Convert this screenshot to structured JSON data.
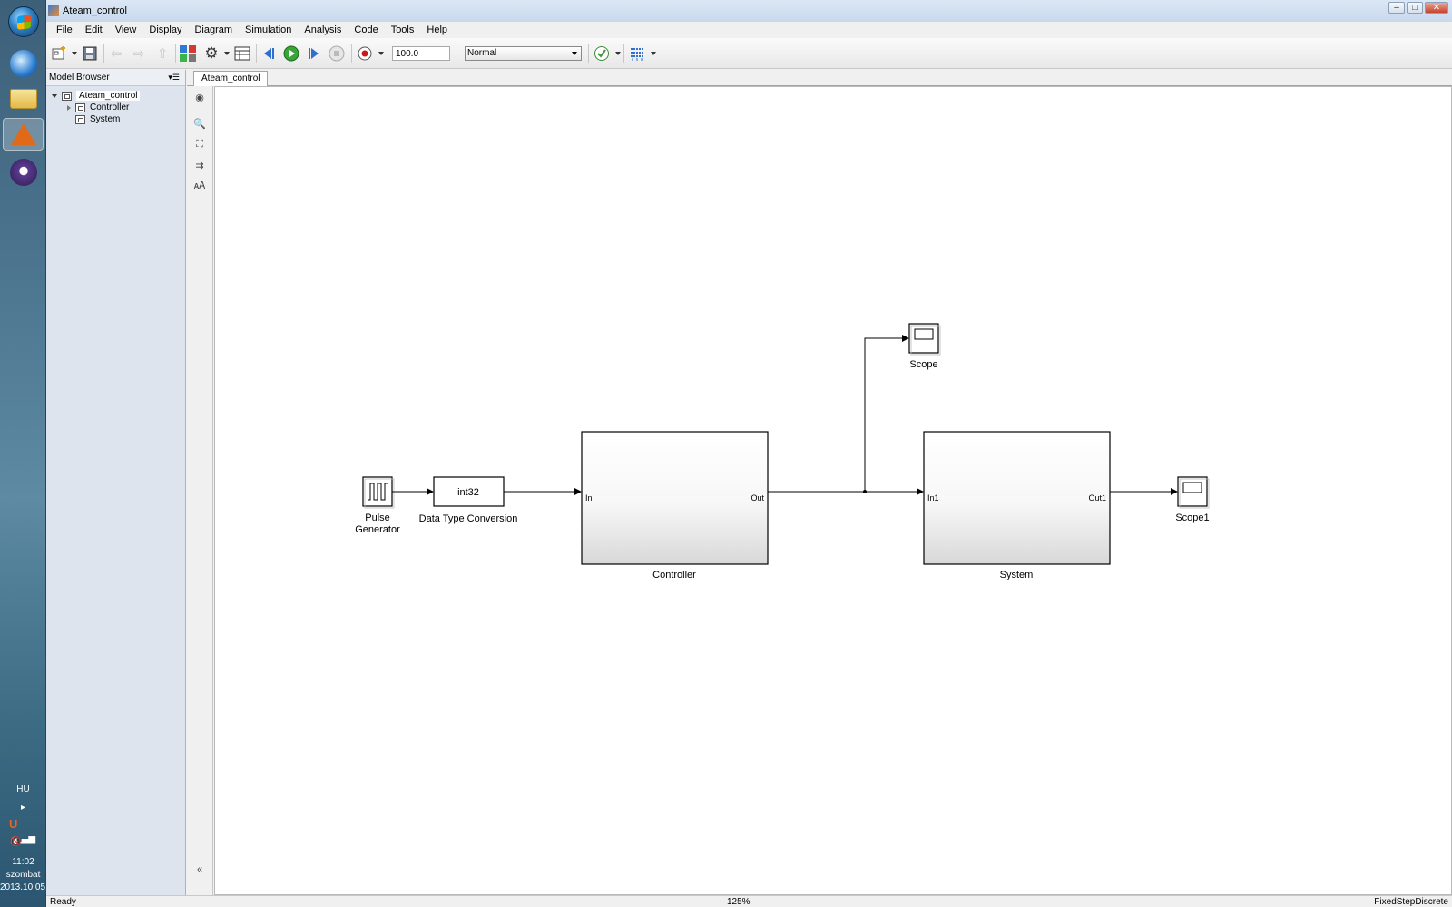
{
  "window": {
    "title": "Ateam_control"
  },
  "menu": [
    "File",
    "Edit",
    "View",
    "Display",
    "Diagram",
    "Simulation",
    "Analysis",
    "Code",
    "Tools",
    "Help"
  ],
  "toolbar": {
    "stop_time": "100.0",
    "sim_mode": "Normal"
  },
  "browser": {
    "header": "Model Browser",
    "tree": [
      {
        "label": "Ateam_control"
      },
      {
        "label": "Controller"
      },
      {
        "label": "System"
      }
    ]
  },
  "tab": {
    "label": "Ateam_control"
  },
  "diagram": {
    "pulse": {
      "label_line1": "Pulse",
      "label_line2": "Generator"
    },
    "dtc": {
      "text": "int32",
      "label": "Data Type Conversion"
    },
    "controller": {
      "label": "Controller",
      "in_port": "In",
      "out_port": "Out"
    },
    "system": {
      "label": "System",
      "in_port": "In1",
      "out_port": "Out1"
    },
    "scope": {
      "label": "Scope"
    },
    "scope1": {
      "label": "Scope1"
    }
  },
  "status": {
    "left": "Ready",
    "zoom": "125%",
    "solver": "FixedStepDiscrete"
  },
  "taskbar": {
    "lang": "HU",
    "time": "11:02",
    "day": "szombat",
    "date": "2013.10.05."
  }
}
